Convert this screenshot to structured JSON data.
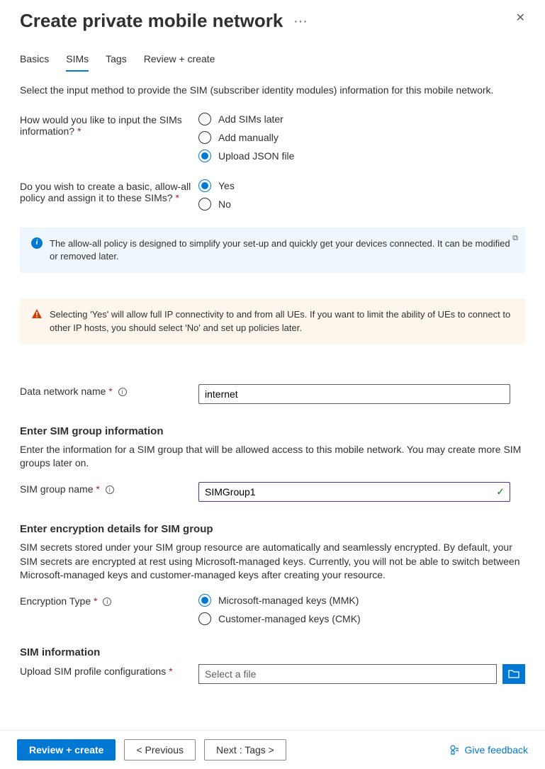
{
  "header": {
    "title": "Create private mobile network"
  },
  "tabs": [
    "Basics",
    "SIMs",
    "Tags",
    "Review + create"
  ],
  "activeTab": 1,
  "intro": "Select the input method to provide the SIM (subscriber identity modules) information for this mobile network.",
  "inputMethod": {
    "label": "How would you like to input the SIMs information?",
    "options": [
      "Add SIMs later",
      "Add manually",
      "Upload JSON file"
    ],
    "selected": 2
  },
  "allowAllPolicy": {
    "label": "Do you wish to create a basic, allow-all policy and assign it to these SIMs?",
    "options": [
      "Yes",
      "No"
    ],
    "selected": 0
  },
  "infoAlert": "The allow-all policy is designed to simplify your set-up and quickly get your devices connected. It can be modified or removed later.",
  "warnAlert": "Selecting 'Yes' will allow full IP connectivity to and from all UEs. If you want to limit the ability of UEs to connect to other IP hosts, you should select 'No' and set up policies later.",
  "dataNetwork": {
    "label": "Data network name",
    "value": "internet"
  },
  "simGroupSection": {
    "heading": "Enter SIM group information",
    "desc": "Enter the information for a SIM group that will be allowed access to this mobile network. You may create more SIM groups later on.",
    "nameLabel": "SIM group name",
    "nameValue": "SIMGroup1"
  },
  "encryptionSection": {
    "heading": "Enter encryption details for SIM group",
    "desc": "SIM secrets stored under your SIM group resource are automatically and seamlessly encrypted. By default, your SIM secrets are encrypted at rest using Microsoft-managed keys. Currently, you will not be able to switch between Microsoft-managed keys and customer-managed keys after creating your resource.",
    "label": "Encryption Type",
    "options": [
      "Microsoft-managed keys (MMK)",
      "Customer-managed keys (CMK)"
    ],
    "selected": 0
  },
  "simInfoSection": {
    "heading": "SIM information",
    "uploadLabel": "Upload SIM profile configurations",
    "placeholder": "Select a file"
  },
  "footer": {
    "review": "Review + create",
    "previous": "< Previous",
    "next": "Next : Tags >",
    "feedback": "Give feedback"
  }
}
